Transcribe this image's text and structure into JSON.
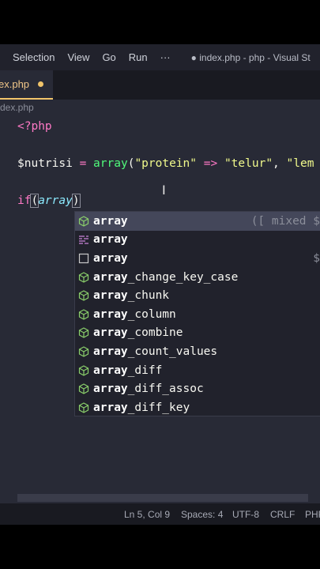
{
  "menu": {
    "items": [
      "Selection",
      "View",
      "Go",
      "Run",
      "···"
    ],
    "window_title": "● index.php - php - Visual St"
  },
  "tab": {
    "label": "ex.php"
  },
  "breadcrumb": "dex.php",
  "code": {
    "line1": "<?php",
    "line2": {
      "var": "$nutrisi",
      "eq": " = ",
      "fn": "array",
      "open": "(",
      "s1": "\"protein\"",
      "arrow": " => ",
      "s2": "\"telur\"",
      "comma": ", ",
      "s3": "\"lem"
    },
    "line3": {
      "kw": "if",
      "open": "(",
      "fn": "array",
      "close": ")"
    }
  },
  "suggestions": [
    {
      "bold": "array",
      "rest": "",
      "icon": "cube-icon",
      "detail": "([ mixed $"
    },
    {
      "bold": "array",
      "rest": "",
      "icon": "keyword-icon",
      "detail": ""
    },
    {
      "bold": "array",
      "rest": "",
      "icon": "snippet-icon",
      "detail": "$"
    },
    {
      "bold": "array",
      "rest": "_change_key_case",
      "icon": "cube-icon",
      "detail": ""
    },
    {
      "bold": "array",
      "rest": "_chunk",
      "icon": "cube-icon",
      "detail": ""
    },
    {
      "bold": "array",
      "rest": "_column",
      "icon": "cube-icon",
      "detail": ""
    },
    {
      "bold": "array",
      "rest": "_combine",
      "icon": "cube-icon",
      "detail": ""
    },
    {
      "bold": "array",
      "rest": "_count_values",
      "icon": "cube-icon",
      "detail": ""
    },
    {
      "bold": "array",
      "rest": "_diff",
      "icon": "cube-icon",
      "detail": ""
    },
    {
      "bold": "array",
      "rest": "_diff_assoc",
      "icon": "cube-icon",
      "detail": ""
    },
    {
      "bold": "array",
      "rest": "_diff_key",
      "icon": "cube-icon",
      "detail": ""
    }
  ],
  "status": {
    "position": "Ln 5, Col 9",
    "spaces": "Spaces: 4",
    "encoding": "UTF-8",
    "eol": "CRLF",
    "language": "PHP"
  },
  "colors": {
    "editor_bg": "#282a36",
    "accent": "#f1c46a",
    "icon_cube": "#8bd06b",
    "icon_keyword": "#c984d9"
  }
}
